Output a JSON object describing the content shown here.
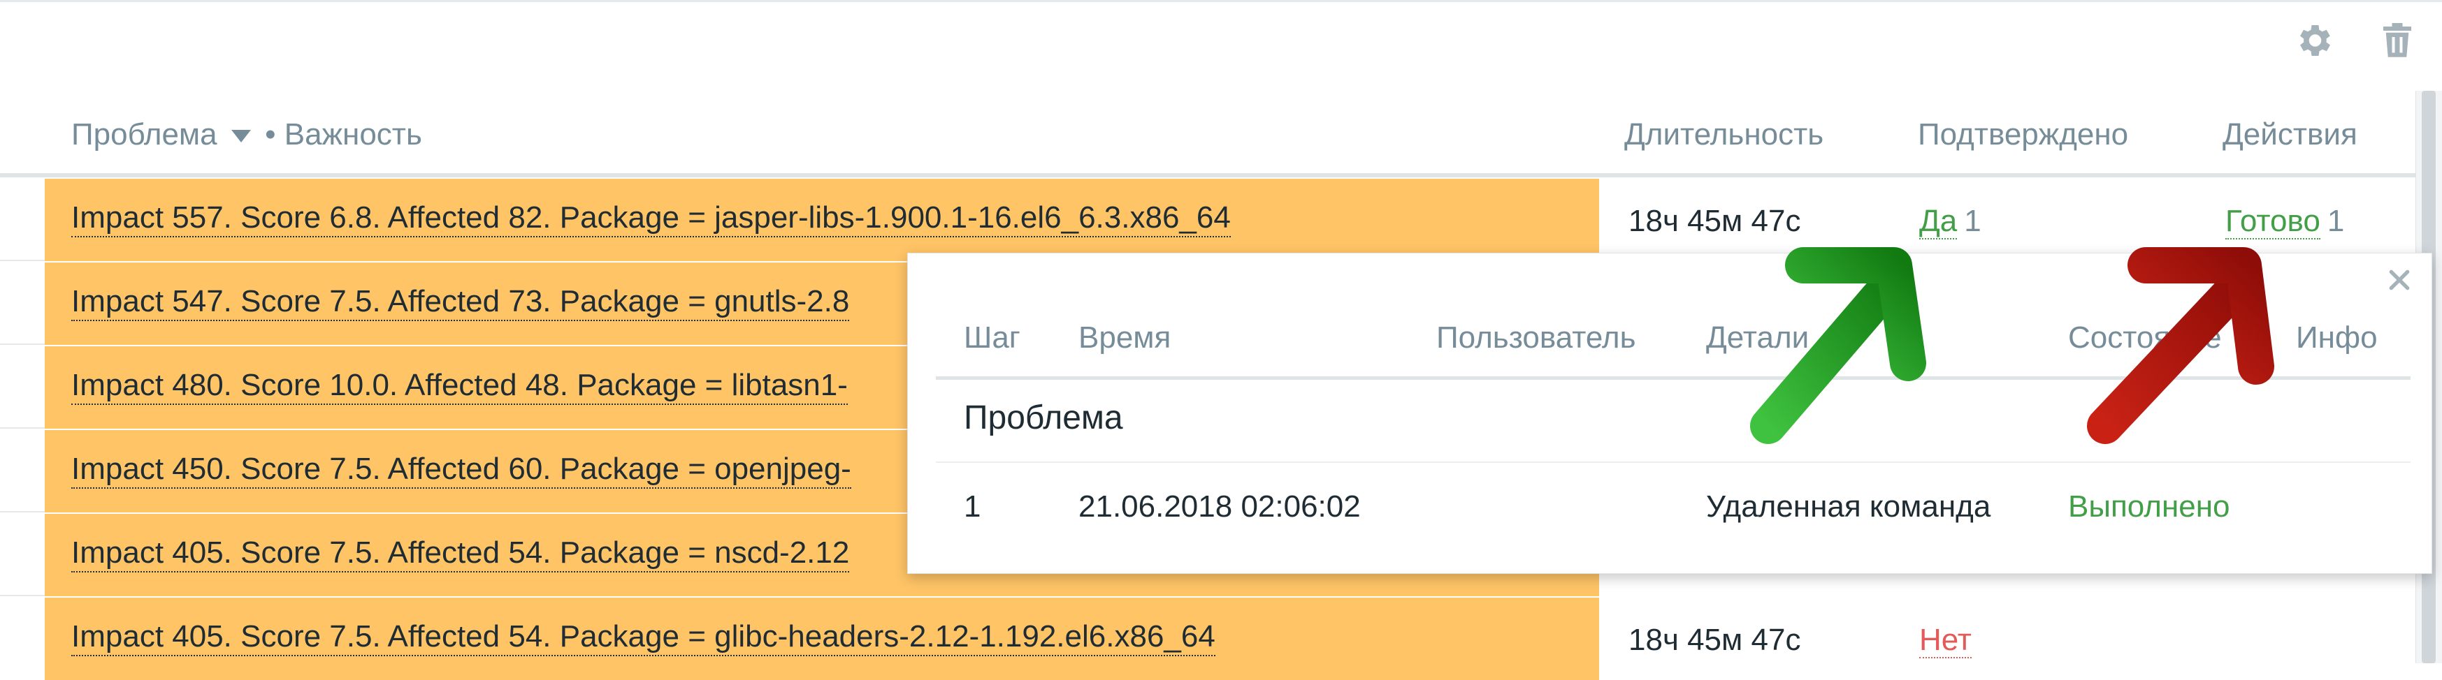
{
  "icons": {
    "settings": "gear-icon",
    "delete": "trash-icon",
    "close": "close-icon",
    "sort": "sort-desc-icon"
  },
  "colors": {
    "problem_bg": "#ffc466",
    "ok_green": "#429e47",
    "no_red": "#e45959",
    "muted": "#768d99",
    "arrow_green": "#2fa82f",
    "arrow_red": "#b5160f"
  },
  "table": {
    "headers": {
      "problem": "Проблема",
      "separator": "•",
      "severity": "Важность",
      "duration": "Длительность",
      "ack": "Подтверждено",
      "actions": "Действия"
    },
    "rows": [
      {
        "problem": "Impact 557. Score 6.8. Affected 82. Package = jasper-libs-1.900.1-16.el6_6.3.x86_64",
        "duration": "18ч 45м 47с",
        "ack": "Да",
        "ack_count": "1",
        "action": "Готово",
        "action_count": "1"
      },
      {
        "problem": "Impact 547. Score 7.5. Affected 73. Package = gnutls-2.8",
        "duration": "",
        "ack": "",
        "ack_count": "",
        "action": "",
        "action_count": ""
      },
      {
        "problem": "Impact 480. Score 10.0. Affected 48. Package = libtasn1-",
        "duration": "",
        "ack": "",
        "ack_count": "",
        "action": "",
        "action_count": ""
      },
      {
        "problem": "Impact 450. Score 7.5. Affected 60. Package = openjpeg-",
        "duration": "",
        "ack": "",
        "ack_count": "",
        "action": "",
        "action_count": ""
      },
      {
        "problem": "Impact 405. Score 7.5. Affected 54. Package = nscd-2.12",
        "duration": "",
        "ack": "",
        "ack_count": "",
        "action": "",
        "action_count": ""
      },
      {
        "problem": "Impact 405. Score 7.5. Affected 54. Package = glibc-headers-2.12-1.192.el6.x86_64",
        "duration": "18ч 45м 47с",
        "ack": "Нет",
        "ack_count": "",
        "action": "",
        "action_count": ""
      }
    ]
  },
  "popup": {
    "headers": {
      "step": "Шаг",
      "time": "Время",
      "user": "Пользователь",
      "details": "Детали",
      "status": "Состояние",
      "info": "Инфо"
    },
    "section": "Проблема",
    "rows": [
      {
        "step": "1",
        "time": "21.06.2018 02:06:02",
        "user": "",
        "details": "Удаленная команда",
        "status": "Выполнено",
        "info": ""
      }
    ]
  }
}
